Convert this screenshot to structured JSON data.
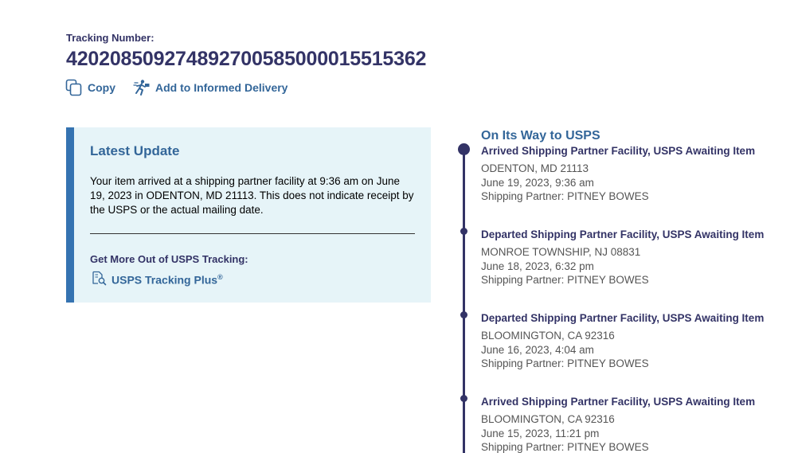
{
  "tracking": {
    "label": "Tracking Number:",
    "number": "420208509274892700585000015515362"
  },
  "actions": {
    "copy_label": "Copy",
    "informed_delivery_label": "Add to Informed Delivery"
  },
  "latest_update": {
    "title": "Latest Update",
    "text": "Your item arrived at a shipping partner facility at 9:36 am on June 19, 2023 in ODENTON, MD 21113. This does not indicate receipt by the USPS or the actual mailing date.",
    "more_title": "Get More Out of USPS Tracking:",
    "plus_link": "USPS Tracking Plus",
    "plus_mark": "®"
  },
  "timeline": {
    "phase": "On Its Way to USPS",
    "events": [
      {
        "title": "Arrived Shipping Partner Facility, USPS Awaiting Item",
        "location": "ODENTON, MD 21113",
        "datetime": "June 19, 2023, 9:36 am",
        "partner": "Shipping Partner: PITNEY BOWES"
      },
      {
        "title": "Departed Shipping Partner Facility, USPS Awaiting Item",
        "location": "MONROE TOWNSHIP, NJ 08831",
        "datetime": "June 18, 2023, 6:32 pm",
        "partner": "Shipping Partner: PITNEY BOWES"
      },
      {
        "title": "Departed Shipping Partner Facility, USPS Awaiting Item",
        "location": "BLOOMINGTON, CA 92316",
        "datetime": "June 16, 2023, 4:04 am",
        "partner": "Shipping Partner: PITNEY BOWES"
      },
      {
        "title": "Arrived Shipping Partner Facility, USPS Awaiting Item",
        "location": "BLOOMINGTON, CA 92316",
        "datetime": "June 15, 2023, 11:21 pm",
        "partner": "Shipping Partner: PITNEY BOWES"
      }
    ]
  },
  "colors": {
    "navy": "#333366",
    "link_blue": "#336699",
    "panel_bg": "#e6f4f8",
    "panel_accent": "#3573b1"
  },
  "icons": {
    "copy": "copy-icon",
    "informed_delivery": "running-carrier-icon",
    "tracking_plus": "document-search-icon"
  }
}
